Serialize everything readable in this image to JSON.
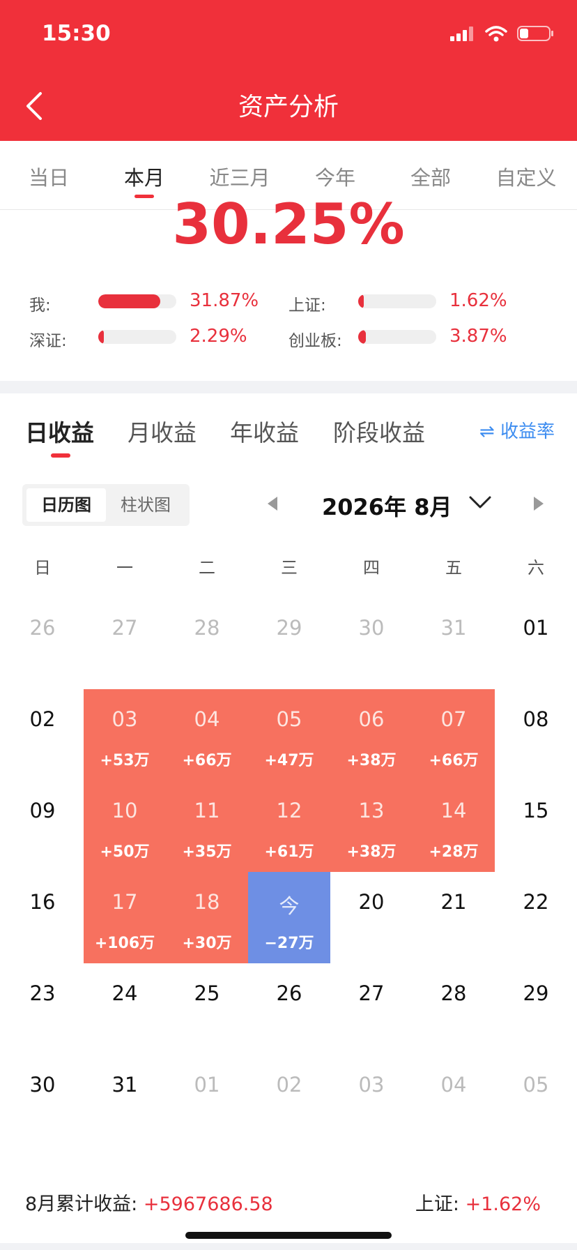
{
  "status_bar": {
    "time": "15:30"
  },
  "header": {
    "title": "资产分析"
  },
  "period_tabs": [
    {
      "label": "当日",
      "active": false
    },
    {
      "label": "本月",
      "active": true
    },
    {
      "label": "近三月",
      "active": false
    },
    {
      "label": "今年",
      "active": false
    },
    {
      "label": "全部",
      "active": false
    },
    {
      "label": "自定义",
      "active": false
    }
  ],
  "summary": {
    "return_pct": "30.25%"
  },
  "comparisons": [
    {
      "label": "我:",
      "value": "31.87%",
      "level_pct": 31.87
    },
    {
      "label": "上证:",
      "value": "1.62%",
      "level_pct": 1.62
    },
    {
      "label": "深证:",
      "value": "2.29%",
      "level_pct": 2.29
    },
    {
      "label": "创业板:",
      "value": "3.87%",
      "level_pct": 3.87
    }
  ],
  "earnings_tabs": [
    {
      "label": "日收益",
      "active": true
    },
    {
      "label": "月收益",
      "active": false
    },
    {
      "label": "年收益",
      "active": false
    },
    {
      "label": "阶段收益",
      "active": false
    }
  ],
  "rate_toggle": {
    "icon": "swap-arrows-icon",
    "label": "收益率"
  },
  "view_toggle": {
    "calendar": "日历图",
    "bar": "柱状图",
    "active": "calendar"
  },
  "month_nav": {
    "title": "2026年 8月"
  },
  "weekdays": [
    "日",
    "一",
    "二",
    "三",
    "四",
    "五",
    "六"
  ],
  "calendar_weeks": [
    [
      {
        "day": "26",
        "other": true
      },
      {
        "day": "27",
        "other": true
      },
      {
        "day": "28",
        "other": true
      },
      {
        "day": "29",
        "other": true
      },
      {
        "day": "30",
        "other": true
      },
      {
        "day": "31",
        "other": true
      },
      {
        "day": "01"
      }
    ],
    [
      {
        "day": "02"
      },
      {
        "day": "03",
        "amount": "+53万",
        "state": "gain"
      },
      {
        "day": "04",
        "amount": "+66万",
        "state": "gain"
      },
      {
        "day": "05",
        "amount": "+47万",
        "state": "gain"
      },
      {
        "day": "06",
        "amount": "+38万",
        "state": "gain"
      },
      {
        "day": "07",
        "amount": "+66万",
        "state": "gain"
      },
      {
        "day": "08"
      }
    ],
    [
      {
        "day": "09"
      },
      {
        "day": "10",
        "amount": "+50万",
        "state": "gain"
      },
      {
        "day": "11",
        "amount": "+35万",
        "state": "gain"
      },
      {
        "day": "12",
        "amount": "+61万",
        "state": "gain"
      },
      {
        "day": "13",
        "amount": "+38万",
        "state": "gain"
      },
      {
        "day": "14",
        "amount": "+28万",
        "state": "gain"
      },
      {
        "day": "15"
      }
    ],
    [
      {
        "day": "16"
      },
      {
        "day": "17",
        "amount": "+106万",
        "state": "gain"
      },
      {
        "day": "18",
        "amount": "+30万",
        "state": "gain"
      },
      {
        "day": "今",
        "amount": "−27万",
        "state": "loss"
      },
      {
        "day": "20"
      },
      {
        "day": "21"
      },
      {
        "day": "22"
      }
    ],
    [
      {
        "day": "23"
      },
      {
        "day": "24"
      },
      {
        "day": "25"
      },
      {
        "day": "26"
      },
      {
        "day": "27"
      },
      {
        "day": "28"
      },
      {
        "day": "29"
      }
    ],
    [
      {
        "day": "30"
      },
      {
        "day": "31"
      },
      {
        "day": "01",
        "other": true
      },
      {
        "day": "02",
        "other": true
      },
      {
        "day": "03",
        "other": true
      },
      {
        "day": "04",
        "other": true
      },
      {
        "day": "05",
        "other": true
      }
    ]
  ],
  "footer": {
    "month_label": "8月累计收益:",
    "month_value": "+5967686.58",
    "index_label": "上证:",
    "index_value": "+1.62%"
  },
  "colors": {
    "brand_red": "#f0303a",
    "gain": "#f7715f",
    "loss": "#6e8fe4",
    "link": "#3c8cf0"
  }
}
